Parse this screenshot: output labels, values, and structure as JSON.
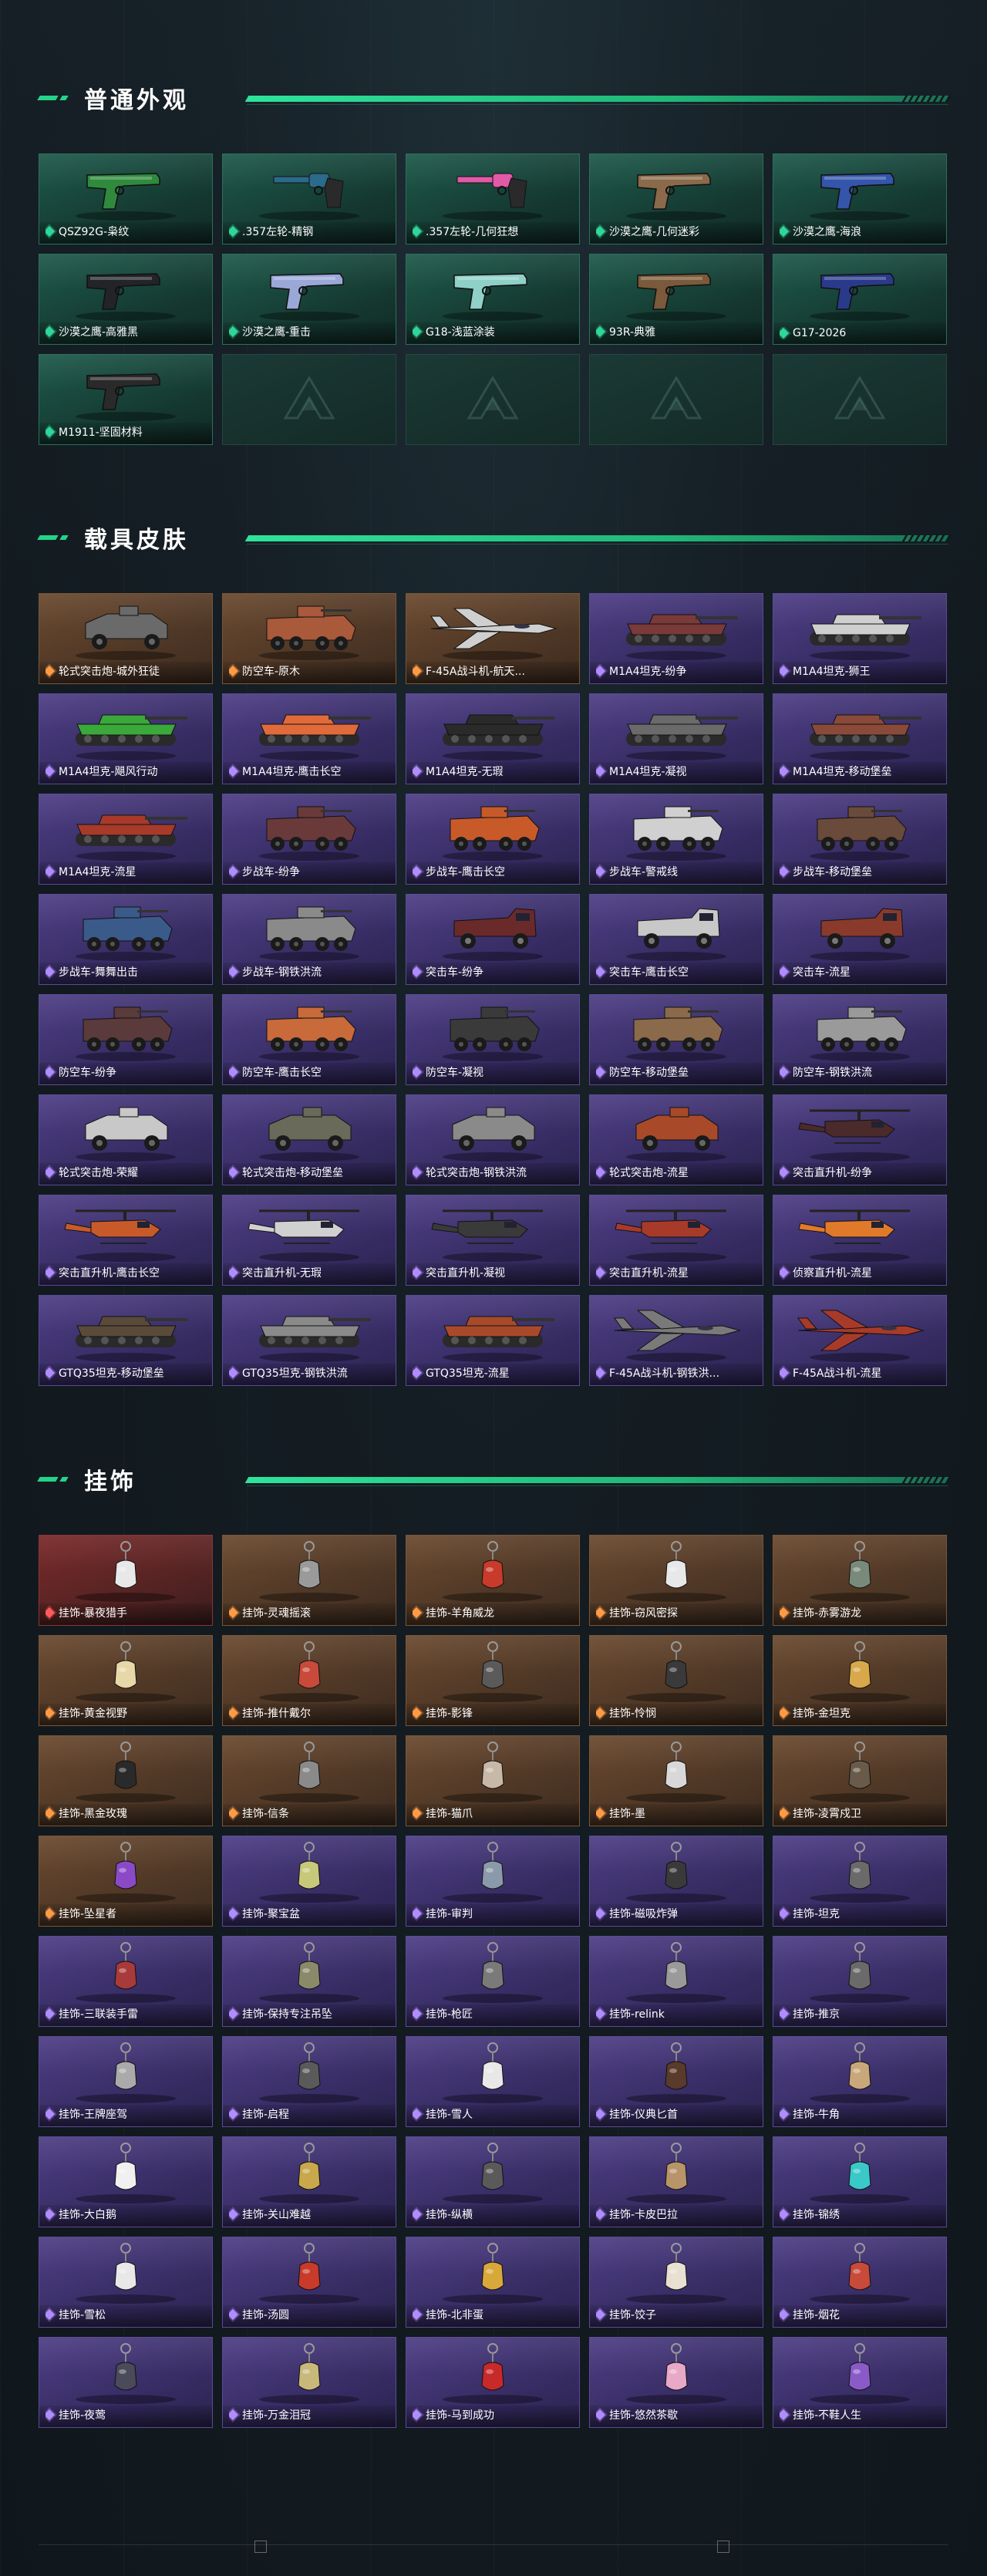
{
  "sections": [
    {
      "title": "普通外观",
      "items": [
        {
          "label": "QSZ92G-枭纹",
          "rarity": "g",
          "kind": "pistol",
          "color": "#2f8a3d"
        },
        {
          "label": ".357左轮-精钢",
          "rarity": "g",
          "kind": "revolver",
          "color": "#2a6a8a"
        },
        {
          "label": ".357左轮-几何狂想",
          "rarity": "g",
          "kind": "revolver",
          "color": "#e05aa8"
        },
        {
          "label": "沙漠之鹰-几何迷彩",
          "rarity": "g",
          "kind": "pistol",
          "color": "#8a6a4a"
        },
        {
          "label": "沙漠之鹰-海浪",
          "rarity": "g",
          "kind": "pistol",
          "color": "#3355aa"
        },
        {
          "label": "沙漠之鹰-高雅黑",
          "rarity": "g",
          "kind": "pistol",
          "color": "#222428"
        },
        {
          "label": "沙漠之鹰-重击",
          "rarity": "g",
          "kind": "pistol",
          "color": "#9aa8d8"
        },
        {
          "label": "G18-浅蓝涂装",
          "rarity": "g",
          "kind": "pistol",
          "color": "#8fd0c8"
        },
        {
          "label": "93R-典雅",
          "rarity": "g",
          "kind": "pistol",
          "color": "#7a5a3a"
        },
        {
          "label": "G17-2026",
          "rarity": "g",
          "kind": "pistol",
          "color": "#2a3a8a"
        },
        {
          "label": "M1911-坚固材料",
          "rarity": "g",
          "kind": "pistol",
          "color": "#2a2a2a"
        },
        {
          "empty": true
        },
        {
          "empty": true
        },
        {
          "empty": true
        },
        {
          "empty": true
        }
      ]
    },
    {
      "title": "载具皮肤",
      "items": [
        {
          "label": "轮式突击炮-城外狂徒",
          "rarity": "o",
          "kind": "armored",
          "color": "#6a6a6a"
        },
        {
          "label": "防空车-原木",
          "rarity": "o",
          "kind": "apc",
          "color": "#a85a3a"
        },
        {
          "label": "F-45A战斗机-航天...",
          "rarity": "o",
          "kind": "jet",
          "color": "#cfcfcf"
        },
        {
          "label": "M1A4坦克-纷争",
          "rarity": "p",
          "kind": "tank",
          "color": "#7a3a3a"
        },
        {
          "label": "M1A4坦克-狮王",
          "rarity": "p",
          "kind": "tank",
          "color": "#cfcfcf"
        },
        {
          "label": "M1A4坦克-飓风行动",
          "rarity": "p",
          "kind": "tank",
          "color": "#3aa83a"
        },
        {
          "label": "M1A4坦克-鹰击长空",
          "rarity": "p",
          "kind": "tank",
          "color": "#e06a3a"
        },
        {
          "label": "M1A4坦克-无瑕",
          "rarity": "p",
          "kind": "tank",
          "color": "#2a2a2a"
        },
        {
          "label": "M1A4坦克-凝视",
          "rarity": "p",
          "kind": "tank",
          "color": "#6a6a6a"
        },
        {
          "label": "M1A4坦克-移动堡垒",
          "rarity": "p",
          "kind": "tank",
          "color": "#8a4a3a"
        },
        {
          "label": "M1A4坦克-流星",
          "rarity": "p",
          "kind": "tank",
          "color": "#a83a2a"
        },
        {
          "label": "步战车-纷争",
          "rarity": "p",
          "kind": "apc",
          "color": "#6a3a3a"
        },
        {
          "label": "步战车-鹰击长空",
          "rarity": "p",
          "kind": "apc",
          "color": "#c85a2a"
        },
        {
          "label": "步战车-警戒线",
          "rarity": "p",
          "kind": "apc",
          "color": "#d0d0d0"
        },
        {
          "label": "步战车-移动堡垒",
          "rarity": "p",
          "kind": "apc",
          "color": "#6a4a3a"
        },
        {
          "label": "步战车-舞舞出击",
          "rarity": "p",
          "kind": "apc",
          "color": "#3a5a8a"
        },
        {
          "label": "步战车-钢铁洪流",
          "rarity": "p",
          "kind": "apc",
          "color": "#8a8a8a"
        },
        {
          "label": "突击车-纷争",
          "rarity": "p",
          "kind": "truck",
          "color": "#6a2a2a"
        },
        {
          "label": "突击车-鹰击长空",
          "rarity": "p",
          "kind": "truck",
          "color": "#c8c8c8"
        },
        {
          "label": "突击车-流星",
          "rarity": "p",
          "kind": "truck",
          "color": "#8a3a2a"
        },
        {
          "label": "防空车-纷争",
          "rarity": "p",
          "kind": "apc",
          "color": "#5a3a3a"
        },
        {
          "label": "防空车-鹰击长空",
          "rarity": "p",
          "kind": "apc",
          "color": "#c86a3a"
        },
        {
          "label": "防空车-凝视",
          "rarity": "p",
          "kind": "apc",
          "color": "#3a3a3a"
        },
        {
          "label": "防空车-移动堡垒",
          "rarity": "p",
          "kind": "apc",
          "color": "#8a6a4a"
        },
        {
          "label": "防空车-钢铁洪流",
          "rarity": "p",
          "kind": "apc",
          "color": "#9a9a9a"
        },
        {
          "label": "轮式突击炮-荣耀",
          "rarity": "p",
          "kind": "armored",
          "color": "#c8c8c8"
        },
        {
          "label": "轮式突击炮-移动堡垒",
          "rarity": "p",
          "kind": "armored",
          "color": "#6a6a5a"
        },
        {
          "label": "轮式突击炮-钢铁洪流",
          "rarity": "p",
          "kind": "armored",
          "color": "#8a8a8a"
        },
        {
          "label": "轮式突击炮-流星",
          "rarity": "p",
          "kind": "armored",
          "color": "#a84a2a"
        },
        {
          "label": "突击直升机-纷争",
          "rarity": "p",
          "kind": "heli",
          "color": "#4a2a2a"
        },
        {
          "label": "突击直升机-鹰击长空",
          "rarity": "p",
          "kind": "heli",
          "color": "#c85a2a"
        },
        {
          "label": "突击直升机-无瑕",
          "rarity": "p",
          "kind": "heli",
          "color": "#d0d0d0"
        },
        {
          "label": "突击直升机-凝视",
          "rarity": "p",
          "kind": "heli",
          "color": "#3a3a3a"
        },
        {
          "label": "突击直升机-流星",
          "rarity": "p",
          "kind": "heli",
          "color": "#a83a2a"
        },
        {
          "label": "侦察直升机-流星",
          "rarity": "p",
          "kind": "heli",
          "color": "#e07a2a"
        },
        {
          "label": "GTQ35坦克-移动堡垒",
          "rarity": "p",
          "kind": "tank",
          "color": "#5a4a3a"
        },
        {
          "label": "GTQ35坦克-钢铁洪流",
          "rarity": "p",
          "kind": "tank",
          "color": "#8a8a8a"
        },
        {
          "label": "GTQ35坦克-流星",
          "rarity": "p",
          "kind": "tank",
          "color": "#a84a2a"
        },
        {
          "label": "F-45A战斗机-钢铁洪...",
          "rarity": "p",
          "kind": "jet",
          "color": "#7a7a7a"
        },
        {
          "label": "F-45A战斗机-流星",
          "rarity": "p",
          "kind": "jet",
          "color": "#a83a2a"
        }
      ]
    },
    {
      "title": "挂饰",
      "items": [
        {
          "label": "挂饰-暴夜猎手",
          "rarity": "r",
          "kind": "charm",
          "color": "#e8e8e8"
        },
        {
          "label": "挂饰-灵魂摇滚",
          "rarity": "o",
          "kind": "charm",
          "color": "#9a9a9a"
        },
        {
          "label": "挂饰-羊角威龙",
          "rarity": "o",
          "kind": "charm",
          "color": "#c83a2a"
        },
        {
          "label": "挂饰-窃风密探",
          "rarity": "o",
          "kind": "charm",
          "color": "#e8e8e8"
        },
        {
          "label": "挂饰-赤雾游龙",
          "rarity": "o",
          "kind": "charm",
          "color": "#7a8a7a"
        },
        {
          "label": "挂饰-黄金视野",
          "rarity": "o",
          "kind": "charm",
          "color": "#e8d8a8"
        },
        {
          "label": "挂饰-推什戴尔",
          "rarity": "o",
          "kind": "charm",
          "color": "#c84a3a"
        },
        {
          "label": "挂饰-影锋",
          "rarity": "o",
          "kind": "charm",
          "color": "#5a5a5a"
        },
        {
          "label": "挂饰-怜悯",
          "rarity": "o",
          "kind": "charm",
          "color": "#3a3a3a"
        },
        {
          "label": "挂饰-金坦克",
          "rarity": "o",
          "kind": "charm",
          "color": "#d8a84a"
        },
        {
          "label": "挂饰-黑金玫瑰",
          "rarity": "o",
          "kind": "charm",
          "color": "#2a2a2a"
        },
        {
          "label": "挂饰-信条",
          "rarity": "o",
          "kind": "charm",
          "color": "#8a8a8a"
        },
        {
          "label": "挂饰-猫爪",
          "rarity": "o",
          "kind": "charm",
          "color": "#c8b8a8"
        },
        {
          "label": "挂饰-墨",
          "rarity": "o",
          "kind": "charm",
          "color": "#d8d8d8"
        },
        {
          "label": "挂饰-凌霄戍卫",
          "rarity": "o",
          "kind": "charm",
          "color": "#6a5a4a"
        },
        {
          "label": "挂饰-坠星者",
          "rarity": "o",
          "kind": "charm",
          "color": "#8a4ac8"
        },
        {
          "label": "挂饰-聚宝盆",
          "rarity": "p",
          "kind": "charm",
          "color": "#c8c87a"
        },
        {
          "label": "挂饰-审判",
          "rarity": "p",
          "kind": "charm",
          "color": "#8a9aaa"
        },
        {
          "label": "挂饰-磁吸炸弹",
          "rarity": "p",
          "kind": "charm",
          "color": "#3a3a3a"
        },
        {
          "label": "挂饰-坦克",
          "rarity": "p",
          "kind": "charm",
          "color": "#6a6a6a"
        },
        {
          "label": "挂饰-三联装手雷",
          "rarity": "p",
          "kind": "charm",
          "color": "#a83a3a"
        },
        {
          "label": "挂饰-保持专注吊坠",
          "rarity": "p",
          "kind": "charm",
          "color": "#8a8a6a"
        },
        {
          "label": "挂饰-枪匠",
          "rarity": "p",
          "kind": "charm",
          "color": "#7a7a7a"
        },
        {
          "label": "挂饰-relink",
          "rarity": "p",
          "kind": "charm",
          "color": "#9a9a9a"
        },
        {
          "label": "挂饰-推京",
          "rarity": "p",
          "kind": "charm",
          "color": "#6a6a6a"
        },
        {
          "label": "挂饰-王牌座驾",
          "rarity": "p",
          "kind": "charm",
          "color": "#aaaaaa"
        },
        {
          "label": "挂饰-启程",
          "rarity": "p",
          "kind": "charm",
          "color": "#5a5a5a"
        },
        {
          "label": "挂饰-雪人",
          "rarity": "p",
          "kind": "charm",
          "color": "#e8e8e8"
        },
        {
          "label": "挂饰-仪典匕首",
          "rarity": "p",
          "kind": "charm",
          "color": "#5a3a2a"
        },
        {
          "label": "挂饰-牛角",
          "rarity": "p",
          "kind": "charm",
          "color": "#c8a87a"
        },
        {
          "label": "挂饰-大白鹅",
          "rarity": "p",
          "kind": "charm",
          "color": "#f0f0f0"
        },
        {
          "label": "挂饰-关山难越",
          "rarity": "p",
          "kind": "charm",
          "color": "#c8a84a"
        },
        {
          "label": "挂饰-纵横",
          "rarity": "p",
          "kind": "charm",
          "color": "#5a5a5a"
        },
        {
          "label": "挂饰-卡皮巴拉",
          "rarity": "p",
          "kind": "charm",
          "color": "#b8946a"
        },
        {
          "label": "挂饰-锦绣",
          "rarity": "p",
          "kind": "charm",
          "color": "#3ac8c8"
        },
        {
          "label": "挂饰-雪松",
          "rarity": "p",
          "kind": "charm",
          "color": "#e8e8e8"
        },
        {
          "label": "挂饰-汤圆",
          "rarity": "p",
          "kind": "charm",
          "color": "#c83a2a"
        },
        {
          "label": "挂饰-北非蛋",
          "rarity": "p",
          "kind": "charm",
          "color": "#d8a83a"
        },
        {
          "label": "挂饰-饺子",
          "rarity": "p",
          "kind": "charm",
          "color": "#e8e0d0"
        },
        {
          "label": "挂饰-烟花",
          "rarity": "p",
          "kind": "charm",
          "color": "#c84a3a"
        },
        {
          "label": "挂饰-夜莺",
          "rarity": "p",
          "kind": "charm",
          "color": "#4a4a5a"
        },
        {
          "label": "挂饰-万金泪冠",
          "rarity": "p",
          "kind": "charm",
          "color": "#c8b87a"
        },
        {
          "label": "挂饰-马到成功",
          "rarity": "p",
          "kind": "charm",
          "color": "#c82a2a"
        },
        {
          "label": "挂饰-悠然茶歇",
          "rarity": "p",
          "kind": "charm",
          "color": "#e8a8c8"
        },
        {
          "label": "挂饰-不鞋人生",
          "rarity": "p",
          "kind": "charm",
          "color": "#8a5ac8"
        }
      ]
    }
  ]
}
